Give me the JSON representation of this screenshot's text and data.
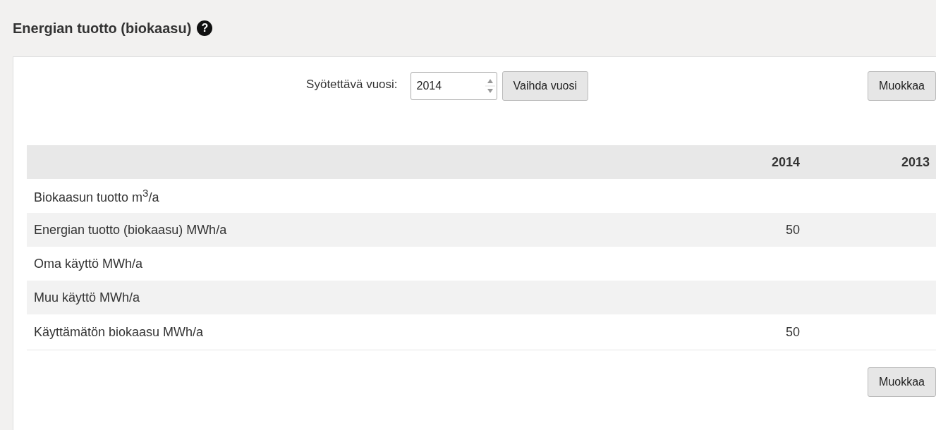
{
  "header": {
    "title": "Energian tuotto (biokaasu)",
    "help_icon": "?"
  },
  "toolbar": {
    "year_label": "Syötettävä vuosi:",
    "year_value": "2014",
    "change_button": "Vaihda vuosi",
    "edit_button": "Muokkaa"
  },
  "table": {
    "columns": [
      "2014",
      "2013"
    ],
    "rows": [
      {
        "label": "Biokaasun tuotto m$^{3}$/a"
      },
      {
        "label": "Energian tuotto (biokaasu) MWh/a",
        "column_1": "50"
      },
      {
        "label": "Oma käyttö MWh/a"
      },
      {
        "label": "Muu käyttö MWh/a"
      },
      {
        "label": "Käyttämätön biokaasu MWh/a",
        "column_1": "50"
      }
    ]
  },
  "footer": {
    "edit_button": "Muokkaa"
  }
}
